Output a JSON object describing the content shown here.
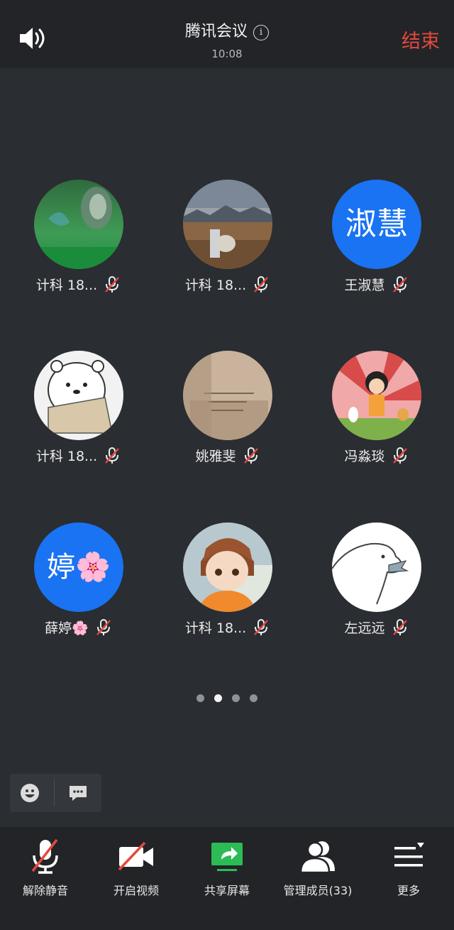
{
  "header": {
    "title": "腾讯会议",
    "info_icon": "i",
    "time": "10:08",
    "end_label": "结束",
    "end_color": "#e5483f"
  },
  "participants": [
    {
      "name": "计科 18...",
      "avatar": "green-fantasy-photo",
      "muted": true
    },
    {
      "name": "计科 18...",
      "avatar": "field-sky-photo",
      "muted": true
    },
    {
      "name": "王淑慧",
      "avatar_text": "淑慧",
      "avatar_color": "#1973f2",
      "muted": true
    },
    {
      "name": "计科 18...",
      "avatar": "white-bear-cartoon",
      "muted": true
    },
    {
      "name": "姚雅斐",
      "avatar": "beige-handwriting-photo",
      "muted": true
    },
    {
      "name": "冯淼琰",
      "avatar": "cartoon-girl-pink",
      "muted": true
    },
    {
      "name": "薛婷🌸",
      "avatar_text": "婷🌸",
      "avatar_color": "#1973f2",
      "muted": true
    },
    {
      "name": "计科 18...",
      "avatar": "anime-boy",
      "muted": true
    },
    {
      "name": "左远远",
      "avatar": "polar-bear-sketch",
      "muted": true
    }
  ],
  "pagination": {
    "pages": 4,
    "current": 2
  },
  "float_bar": {
    "emoji_icon": "emoji-icon",
    "chat_icon": "chat-icon"
  },
  "toolbar": {
    "unmute": "解除静音",
    "video": "开启视频",
    "share": "共享屏幕",
    "members": "管理成员(33)",
    "more": "更多",
    "share_color": "#2dbb55"
  }
}
